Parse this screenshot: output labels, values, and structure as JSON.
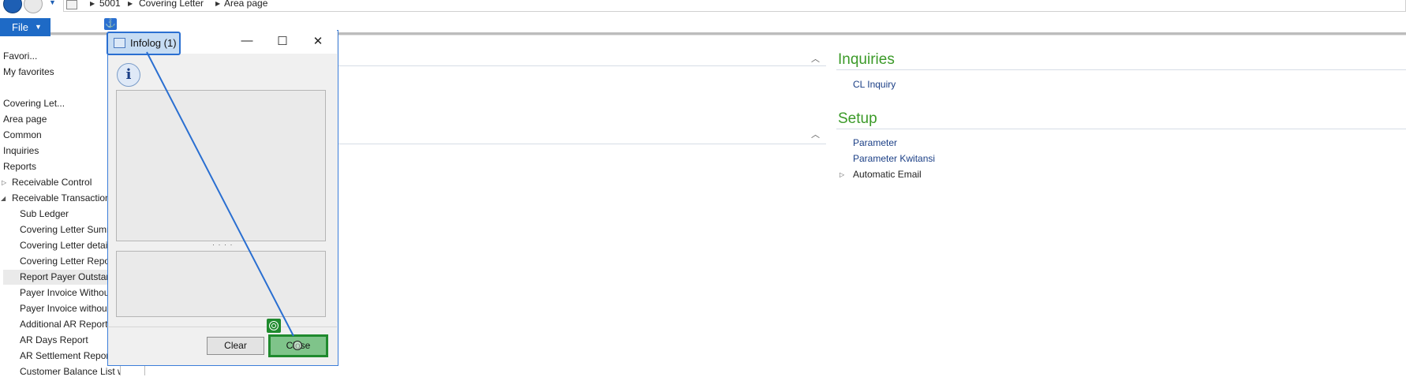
{
  "address_bar": {
    "crumbs": [
      "5001",
      "Covering Letter",
      "Area page"
    ]
  },
  "ribbon": {
    "file_label": "File"
  },
  "nav_pane": {
    "items": [
      "Favori...",
      "My favorites",
      "Covering Let...",
      "Area page",
      "Common",
      "Inquiries",
      "Reports"
    ],
    "groups": [
      "Receivable Control",
      "Receivable Transaction"
    ],
    "sub_items": [
      "Sub Ledger",
      "Covering Letter Summ",
      "Covering Letter detai",
      "Covering Letter Repo",
      "Report Payer Outstan",
      "Payer Invoice Withou",
      "Payer Invoice withou",
      "Additional AR Report",
      "AR Days Report",
      "AR Settlement Repor",
      "Customer Balance List with..."
    ]
  },
  "content": {
    "inquiries": {
      "title": "Inquiries",
      "links": [
        "CL Inquiry"
      ]
    },
    "setup": {
      "title": "Setup",
      "links": [
        "Parameter",
        "Parameter Kwitansi"
      ],
      "expandable": "Automatic Email"
    }
  },
  "dialog": {
    "title": "Infolog (1)",
    "info_icon_glyph": "i",
    "splitter": "· · · ·",
    "clear_label": "Clear",
    "close_label": "Close",
    "minimize_glyph": "—",
    "maximize_glyph": "☐",
    "close_glyph": "✕"
  },
  "colors": {
    "accent": "#1e6ac6",
    "section_header": "#3b9a28",
    "link": "#1b3f86",
    "highlight_green": "#1f8a2e"
  }
}
